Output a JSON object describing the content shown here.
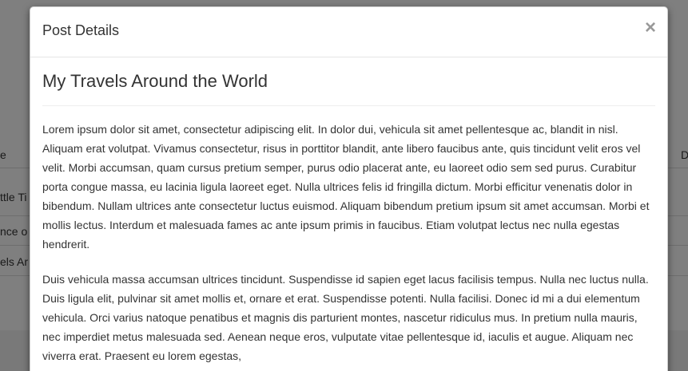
{
  "background": {
    "left_cells": [
      "ttle Ti",
      "nce o",
      "els Ar"
    ],
    "left_header": "e",
    "right_header": "D"
  },
  "modal": {
    "title": "Post Details",
    "close_label": "×",
    "post": {
      "title": "My Travels Around the World",
      "paragraphs": [
        "Lorem ipsum dolor sit amet, consectetur adipiscing elit. In dolor dui, vehicula sit amet pellentesque ac, blandit in nisl. Aliquam erat volutpat. Vivamus consectetur, risus in porttitor blandit, ante libero faucibus ante, quis tincidunt velit eros vel velit. Morbi accumsan, quam cursus pretium semper, purus odio placerat ante, eu laoreet odio sem sed purus. Curabitur porta congue massa, eu lacinia ligula laoreet eget. Nulla ultrices felis id fringilla dictum. Morbi efficitur venenatis dolor in bibendum. Nullam ultrices ante consectetur luctus euismod. Aliquam bibendum pretium ipsum sit amet accumsan. Morbi et mollis lectus. Interdum et malesuada fames ac ante ipsum primis in faucibus. Etiam volutpat lectus nec nulla egestas hendrerit.",
        "Duis vehicula massa accumsan ultrices tincidunt. Suspendisse id sapien eget lacus facilisis tempus. Nulla nec luctus nulla. Duis ligula elit, pulvinar sit amet mollis et, ornare et erat. Suspendisse potenti. Nulla facilisi. Donec id mi a dui elementum vehicula. Orci varius natoque penatibus et magnis dis parturient montes, nascetur ridiculus mus. In pretium nulla mauris, nec imperdiet metus malesuada sed. Aenean neque eros, vulputate vitae pellentesque id, iaculis et augue. Aliquam nec viverra erat. Praesent eu lorem egestas,"
      ]
    }
  }
}
